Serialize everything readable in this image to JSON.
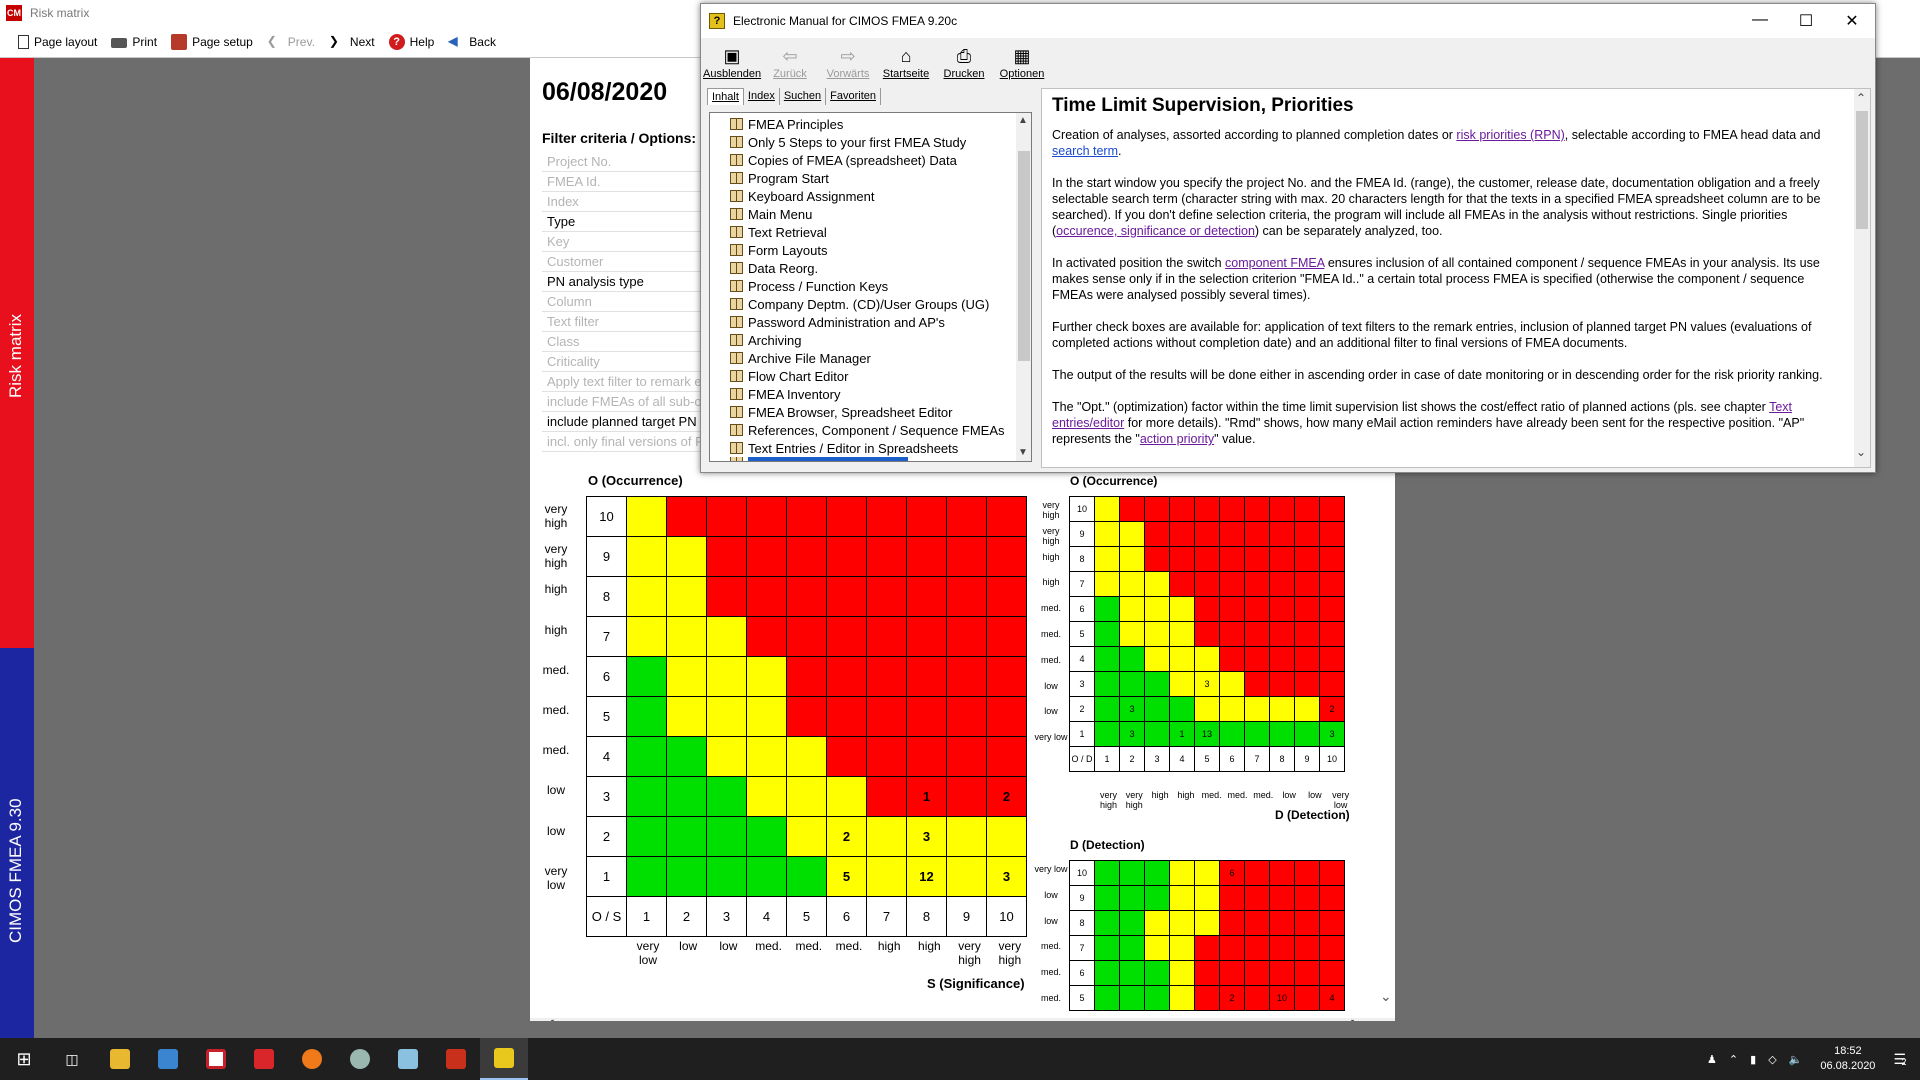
{
  "app": {
    "title": "Risk matrix",
    "logo": "CM",
    "toolbar": [
      {
        "label": "Page layout",
        "icon": "page-layout-icon",
        "disabled": false
      },
      {
        "label": "Print",
        "icon": "printer-icon",
        "disabled": false
      },
      {
        "label": "Page setup",
        "icon": "page-setup-icon",
        "disabled": false
      },
      {
        "label": "Prev.",
        "icon": "chevron-left-icon",
        "disabled": true
      },
      {
        "label": "Next",
        "icon": "chevron-right-icon",
        "disabled": false
      },
      {
        "label": "Help",
        "icon": "help-icon",
        "disabled": false
      },
      {
        "label": "Back",
        "icon": "back-arrow-icon",
        "disabled": false
      }
    ],
    "side_top": "Risk matrix",
    "side_bottom": "CIMOS FMEA 9.30"
  },
  "report": {
    "date": "06/08/2020",
    "filter_title": "Filter criteria / Options:",
    "filters": [
      {
        "label": "Project No.",
        "active": false
      },
      {
        "label": "FMEA Id.",
        "active": false
      },
      {
        "label": "Index",
        "active": false
      },
      {
        "label": "Type",
        "active": true
      },
      {
        "label": "Key",
        "active": false
      },
      {
        "label": "Customer",
        "active": false
      },
      {
        "label": "PN analysis type",
        "active": true
      },
      {
        "label": "Column",
        "active": false
      },
      {
        "label": "Text filter",
        "active": false
      },
      {
        "label": "Class",
        "active": false
      },
      {
        "label": "Criticality",
        "active": false
      },
      {
        "label": "Apply text filter to remark e",
        "active": false
      },
      {
        "label": "include FMEAs of all sub-o",
        "active": false
      },
      {
        "label": "include planned target PN",
        "active": true
      },
      {
        "label": "incl. only final versions of F",
        "active": false
      }
    ]
  },
  "matrix_big": {
    "y_caption": "O (Occurrence)",
    "x_caption": "S (Significance)",
    "corner": "O / S",
    "row_values": [
      "10",
      "9",
      "8",
      "7",
      "6",
      "5",
      "4",
      "3",
      "2",
      "1"
    ],
    "row_levels": [
      "very high",
      "very high",
      "high",
      "high",
      "med.",
      "med.",
      "med.",
      "low",
      "low",
      "very low"
    ],
    "col_values": [
      "1",
      "2",
      "3",
      "4",
      "5",
      "6",
      "7",
      "8",
      "9",
      "10"
    ],
    "col_levels": [
      "very low",
      "low",
      "low",
      "med.",
      "med.",
      "med.",
      "high",
      "high",
      "very high",
      "very high"
    ],
    "colors": [
      "yrrrrrrrrr",
      "yyrrrrrrrr",
      "yyrrrrrrrr",
      "yyyrrrrrrr",
      "gyyyrrrrrr",
      "gyyyrrrrrr",
      "ggyyyrrrrr",
      "gggyyyrrrr",
      "ggggyyyyyy",
      "gggggyyyyy"
    ],
    "counts": [
      [
        "",
        "",
        "",
        "",
        "",
        "",
        "",
        "",
        "",
        ""
      ],
      [
        "",
        "",
        "",
        "",
        "",
        "",
        "",
        "",
        "",
        ""
      ],
      [
        "",
        "",
        "",
        "",
        "",
        "",
        "",
        "",
        "",
        ""
      ],
      [
        "",
        "",
        "",
        "",
        "",
        "",
        "",
        "",
        "",
        ""
      ],
      [
        "",
        "",
        "",
        "",
        "",
        "",
        "",
        "",
        "",
        ""
      ],
      [
        "",
        "",
        "",
        "",
        "",
        "",
        "",
        "",
        "",
        ""
      ],
      [
        "",
        "",
        "",
        "",
        "",
        "",
        "",
        "",
        "",
        ""
      ],
      [
        "",
        "",
        "",
        "",
        "",
        "",
        "",
        "1",
        "",
        "2"
      ],
      [
        "",
        "",
        "",
        "",
        "",
        "2",
        "",
        "3",
        "",
        ""
      ],
      [
        "",
        "",
        "",
        "",
        "",
        "5",
        "",
        "12",
        "",
        "3"
      ]
    ]
  },
  "matrix_occ": {
    "y_caption": "O (Occurrence)",
    "x_caption": "D (Detection)",
    "corner": "O / D",
    "row_values": [
      "10",
      "9",
      "8",
      "7",
      "6",
      "5",
      "4",
      "3",
      "2",
      "1"
    ],
    "row_levels": [
      "very high",
      "very high",
      "high",
      "high",
      "med.",
      "med.",
      "med.",
      "low",
      "low",
      "very low"
    ],
    "col_values": [
      "1",
      "2",
      "3",
      "4",
      "5",
      "6",
      "7",
      "8",
      "9",
      "10"
    ],
    "col_levels": [
      "very high",
      "very high",
      "high",
      "high",
      "med.",
      "med.",
      "med.",
      "low",
      "low",
      "very low"
    ],
    "colors": [
      "yrrrrrrrrr",
      "yyrrrrrrrr",
      "yyrrrrrrrr",
      "yyyrrrrrrr",
      "gyyyrrrrrr",
      "gyyyrrrrrr",
      "ggyyyrrrrr",
      "gggyyyrrrr",
      "ggggyyyyyr",
      "gggggggggg"
    ],
    "counts": [
      [
        "",
        "",
        "",
        "",
        "",
        "",
        "",
        "",
        "",
        ""
      ],
      [
        "",
        "",
        "",
        "",
        "",
        "",
        "",
        "",
        "",
        ""
      ],
      [
        "",
        "",
        "",
        "",
        "",
        "",
        "",
        "",
        "",
        ""
      ],
      [
        "",
        "",
        "",
        "",
        "",
        "",
        "",
        "",
        "",
        ""
      ],
      [
        "",
        "",
        "",
        "",
        "",
        "",
        "",
        "",
        "",
        ""
      ],
      [
        "",
        "",
        "",
        "",
        "",
        "",
        "",
        "",
        "",
        ""
      ],
      [
        "",
        "",
        "",
        "",
        "",
        "",
        "",
        "",
        "",
        ""
      ],
      [
        "",
        "",
        "",
        "",
        "3",
        "",
        "",
        "",
        "",
        ""
      ],
      [
        "",
        "3",
        "",
        "",
        "",
        "",
        "",
        "",
        "",
        "2"
      ],
      [
        "",
        "3",
        "",
        "1",
        "13",
        "",
        "",
        "",
        "",
        "3"
      ]
    ]
  },
  "matrix_det": {
    "y_caption": "D (Detection)",
    "row_values": [
      "10",
      "9",
      "8",
      "7",
      "6",
      "5"
    ],
    "row_levels": [
      "very low",
      "low",
      "low",
      "med.",
      "med.",
      "med."
    ],
    "colors": [
      "gggyyrrrrr",
      "gggyyrrrrr",
      "ggyyyrrrrr",
      "ggyyrrrrrr",
      "gggyrrrrrr",
      "gggyrrrrrr"
    ],
    "counts": [
      [
        "",
        "",
        "",
        "",
        "",
        "6",
        "",
        "",
        "",
        ""
      ],
      [
        "",
        "",
        "",
        "",
        "",
        "",
        "",
        "",
        "",
        ""
      ],
      [
        "",
        "",
        "",
        "",
        "",
        "",
        "",
        "",
        "",
        ""
      ],
      [
        "",
        "",
        "",
        "",
        "",
        "",
        "",
        "",
        "",
        ""
      ],
      [
        "",
        "",
        "",
        "",
        "",
        "",
        "",
        "",
        "",
        ""
      ],
      [
        "",
        "",
        "",
        "",
        "",
        "2",
        "",
        "10",
        "",
        "4"
      ]
    ]
  },
  "help": {
    "title": "Electronic Manual for CIMOS FMEA 9.20c",
    "toolbar": [
      {
        "label": "Ausblenden",
        "icon": "hide-pane-icon",
        "disabled": false
      },
      {
        "label": "Zurück",
        "icon": "back-arrow-icon",
        "disabled": true
      },
      {
        "label": "Vorwärts",
        "icon": "forward-arrow-icon",
        "disabled": true
      },
      {
        "label": "Startseite",
        "icon": "home-icon",
        "disabled": false
      },
      {
        "label": "Drucken",
        "icon": "printer-icon",
        "disabled": false
      },
      {
        "label": "Optionen",
        "icon": "options-icon",
        "disabled": false
      }
    ],
    "tabs": [
      "Inhalt",
      "Index",
      "Suchen",
      "Favoriten"
    ],
    "toc": [
      "FMEA Principles",
      "Only 5 Steps to your first FMEA Study",
      "Copies of FMEA (spreadsheet) Data",
      "Program Start",
      "Keyboard Assignment",
      "Main Menu",
      "Text Retrieval",
      "Form Layouts",
      "Data Reorg.",
      "Process / Function Keys",
      "Company Deptm. (CD)/User Groups (UG)",
      "Password Administration and AP's",
      "Archiving",
      "Archive File Manager",
      "Flow Chart Editor",
      "FMEA Inventory",
      "FMEA Browser, Spreadsheet Editor",
      "References, Component / Sequence FMEAs",
      "Text Entries / Editor in Spreadsheets"
    ],
    "content_title": "Time Limit Supervision, Priorities",
    "p1a": "Creation of analyses, assorted according to planned completion dates or ",
    "p1_link1": "risk priorities (RPN)",
    "p1b": ", selectable according to FMEA head data and ",
    "p1_link2": "search term",
    "p1c": ".",
    "p2a": "In the start window you specify the project No. and the FMEA Id. (range), the customer, release date, documentation obligation and a freely selectable search term (character string with max. 20 characters length for that the texts in a specified FMEA spreadsheet column are to be searched). If you don't define selection criteria, the program will include all FMEAs in the analysis without restrictions. Single priorities (",
    "p2_link": "occurence, significance or detection",
    "p2b": ") can be separately analyzed, too.",
    "p3a": "In activated position the switch ",
    "p3_link": "component FMEA",
    "p3b": " ensures inclusion of all contained component / sequence FMEAs in your analysis. Its use makes sense only if in the selection criterion \"FMEA Id..\" a certain total process FMEA is specified (otherwise the component / sequence FMEAs were analysed possibly several times).",
    "p4": "Further check boxes are available for: application of text filters to the remark entries, inclusion of planned target PN values (evaluations of completed actions without completion date) and an additional filter to final versions of FMEA documents.",
    "p5": "The output of the results will be done either in ascending order in case of date monitoring or in descending order for the risk priority ranking.",
    "p6a": "The \"Opt.\" (optimization) factor within the time limit supervision list shows the cost/effect ratio of planned actions (pls. see chapter ",
    "p6_link1": "Text entries/editor",
    "p6b": " for more details). \"Rmd\" shows, how many eMail action reminders have already been sent for the respective position. \"AP\" represents the \"",
    "p6_link2": "action priority",
    "p6c": "\" value."
  },
  "taskbar": {
    "time": "18:52",
    "date": "06.08.2020",
    "notifications": "2"
  }
}
